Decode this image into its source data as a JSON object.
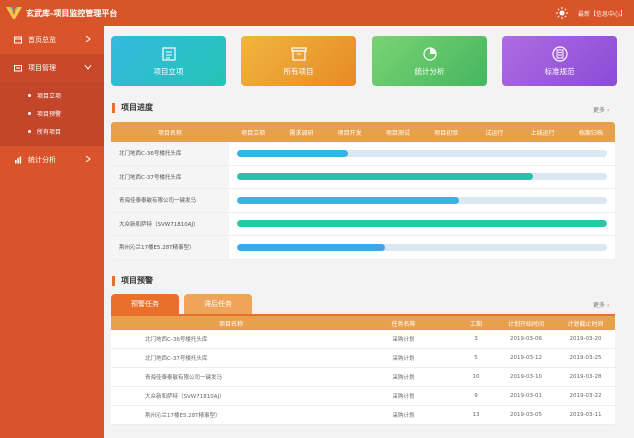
{
  "header": {
    "title": "玄武库-项目监控管理平台",
    "user_text": "最新【信息中心】"
  },
  "sidebar": {
    "items": [
      {
        "label": "首页总览"
      },
      {
        "label": "项目管理"
      },
      {
        "label": "统计分析"
      }
    ],
    "sub_items": [
      {
        "label": "项目立项"
      },
      {
        "label": "项目预警"
      },
      {
        "label": "所有项目"
      }
    ]
  },
  "cards": [
    {
      "label": "项目立项",
      "icon": "project-setup-icon"
    },
    {
      "label": "所有项目",
      "icon": "box-icon"
    },
    {
      "label": "统计分析",
      "icon": "pie-chart-icon"
    },
    {
      "label": "标准规范",
      "icon": "document-icon"
    }
  ],
  "progress": {
    "title": "项目进度",
    "more": "更多",
    "name_header": "项目名称",
    "stages": [
      "项目立项",
      "需求调研",
      "项目开发",
      "项目测试",
      "项目初验",
      "试运行",
      "上线运行",
      "档案归档"
    ],
    "rows": [
      {
        "name": "北门地西C-36号楼托头库",
        "percent": 30,
        "color": "#35b2e8"
      },
      {
        "name": "北门地西C-37号楼托头库",
        "percent": 80,
        "color": "#22c4b0"
      },
      {
        "name": "青海佳泰泰敏有限公司一键发马",
        "percent": 60,
        "color": "#32b6e0"
      },
      {
        "name": "大众新和萨特（SVW71810AJ）",
        "percent": 100,
        "color": "#27c9a5"
      },
      {
        "name": "荆州沁兰17楼E5.28T精事型）",
        "percent": 40,
        "color": "#3aa8ea"
      }
    ]
  },
  "warning": {
    "title": "项目预警",
    "more": "更多",
    "tabs": [
      "预警任务",
      "滞后任务"
    ],
    "headers": {
      "name": "项目名称",
      "task": "任务名称",
      "duration": "工期",
      "start": "计划开始时间",
      "end": "计划截止时间"
    },
    "rows": [
      {
        "name": "北门地西C-36号楼托头库",
        "task": "采购计划",
        "duration": "3",
        "start": "2019-03-06",
        "end": "2019-03-20"
      },
      {
        "name": "北门地西C-37号楼托头库",
        "task": "采购计划",
        "duration": "5",
        "start": "2019-03-12",
        "end": "2019-03-25"
      },
      {
        "name": "青海佳泰泰敏有限公司一键发马",
        "task": "采购计划",
        "duration": "10",
        "start": "2019-03-10",
        "end": "2019-03-28"
      },
      {
        "name": "大众新和萨特（SVW71810AJ）",
        "task": "采购计划",
        "duration": "9",
        "start": "2019-03-01",
        "end": "2019-03-22"
      },
      {
        "name": "荆州沁兰17楼E5.28T精事型）",
        "task": "采购计划",
        "duration": "13",
        "start": "2019-03-05",
        "end": "2019-03-11"
      }
    ]
  }
}
